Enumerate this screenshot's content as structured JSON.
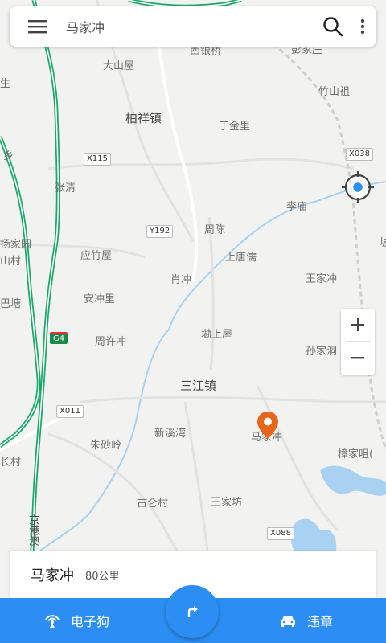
{
  "search": {
    "text": "马家冲"
  },
  "map": {
    "places": [
      {
        "id": "xiyinqiao",
        "name": "西银桥"
      },
      {
        "id": "pengjiazhuang",
        "name": "彭家庄"
      },
      {
        "id": "dashanwu",
        "name": "大山屋"
      },
      {
        "id": "zhushanzu",
        "name": "竹山祖"
      },
      {
        "id": "boxiangzhen",
        "name": "柏祥镇"
      },
      {
        "id": "yujinli",
        "name": "于金里"
      },
      {
        "id": "zhangqing",
        "name": "张清"
      },
      {
        "id": "limiao",
        "name": "李庙"
      },
      {
        "id": "zhouchen",
        "name": "周陈"
      },
      {
        "id": "yingzhuwu",
        "name": "应竹屋"
      },
      {
        "id": "shangtangru",
        "name": "上唐儒"
      },
      {
        "id": "xiaochong",
        "name": "肖冲"
      },
      {
        "id": "wangjiachong",
        "name": "王家冲"
      },
      {
        "id": "anchongli",
        "name": "安冲里"
      },
      {
        "id": "kanshangwu",
        "name": "墈上屋"
      },
      {
        "id": "zhouxuchong",
        "name": "周许冲"
      },
      {
        "id": "sunjiadong",
        "name": "孙家洞"
      },
      {
        "id": "sanjiangzhen",
        "name": "三江镇"
      },
      {
        "id": "xinxiwan",
        "name": "新溪湾"
      },
      {
        "id": "majiachong",
        "name": "马家冲"
      },
      {
        "id": "zhushaling",
        "name": "朱砂岭"
      },
      {
        "id": "zhangjiaju",
        "name": "樟家咀("
      },
      {
        "id": "gulun",
        "name": "古仑村"
      },
      {
        "id": "wangjiafang",
        "name": "王家坊"
      },
      {
        "id": "edge_xiang",
        "name": "乡"
      },
      {
        "id": "edge_sheng",
        "name": "生"
      },
      {
        "id": "edge_yangjiayuan",
        "name": "扬家园"
      },
      {
        "id": "edge_shancun",
        "name": "山村"
      },
      {
        "id": "edge_batang",
        "name": "巴塘"
      },
      {
        "id": "edge_xiacun",
        "name": "长村"
      },
      {
        "id": "edge_bo",
        "name": "坡"
      }
    ],
    "roads": {
      "x115": "X115",
      "y192": "Y192",
      "x038": "X038",
      "x011": "X011",
      "x088": "X088",
      "g4": "G4",
      "expressway": "京港澳"
    }
  },
  "info_card": {
    "name": "马家冲",
    "distance": "80公里"
  },
  "bottom_bar": {
    "left_label": "电子狗",
    "right_label": "违章"
  },
  "colors": {
    "accent": "#2c8ef2",
    "pin": "#e8661c",
    "expressway": "#1aa86b",
    "water": "#a9d2f2"
  }
}
